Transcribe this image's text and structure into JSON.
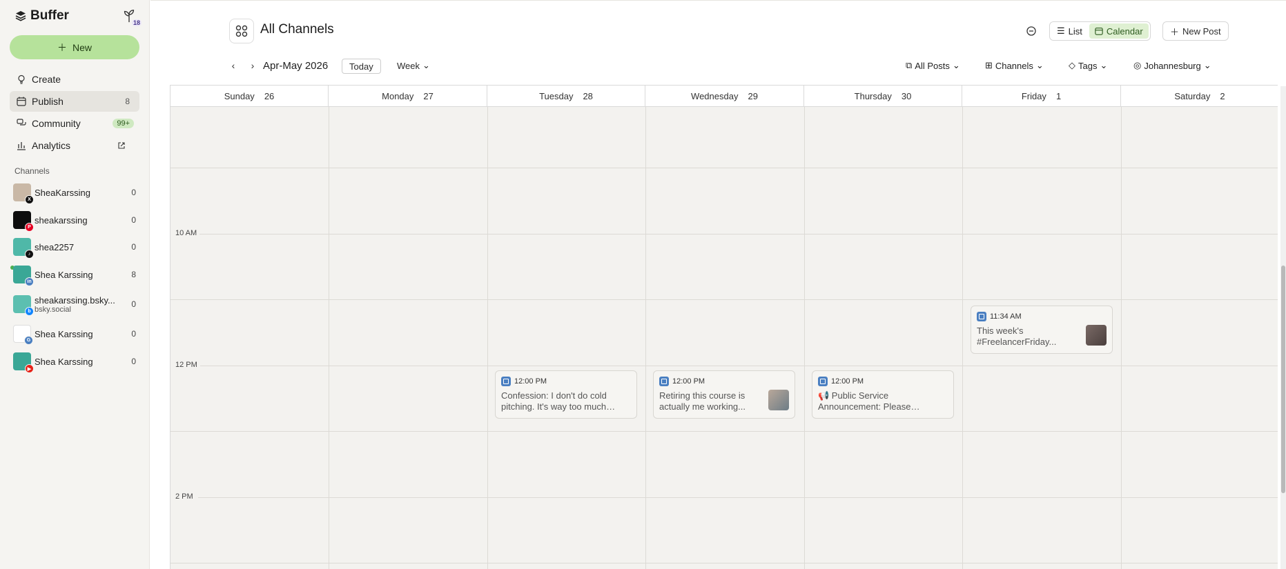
{
  "brand": {
    "name": "Buffer",
    "sprout_count": "18"
  },
  "sidebar": {
    "new_label": "New",
    "items": [
      {
        "label": "Create",
        "count": ""
      },
      {
        "label": "Publish",
        "count": "8"
      },
      {
        "label": "Community",
        "count": "99+"
      },
      {
        "label": "Analytics",
        "count": ""
      }
    ],
    "channels_title": "Channels",
    "channels": [
      {
        "name": "SheaKarssing",
        "sub": "",
        "count": "0",
        "network": "x-icon"
      },
      {
        "name": "sheakarssing",
        "sub": "",
        "count": "0",
        "network": "pinterest-icon"
      },
      {
        "name": "shea2257",
        "sub": "",
        "count": "0",
        "network": "tiktok-icon"
      },
      {
        "name": "Shea Karssing",
        "sub": "",
        "count": "8",
        "network": "linkedin-icon"
      },
      {
        "name": "sheakarssing.bsky...",
        "sub": "bsky.social",
        "count": "0",
        "network": "bluesky-icon"
      },
      {
        "name": "Shea Karssing",
        "sub": "",
        "count": "0",
        "network": "google-business-icon"
      },
      {
        "name": "Shea Karssing",
        "sub": "",
        "count": "0",
        "network": "youtube-icon"
      }
    ]
  },
  "header": {
    "title": "All Channels",
    "list_label": "List",
    "calendar_label": "Calendar",
    "new_post_label": "New Post",
    "range": "Apr-May 2026",
    "today_label": "Today",
    "week_label": "Week",
    "filters": {
      "posts": "All Posts",
      "channels": "Channels",
      "tags": "Tags",
      "timezone": "Johannesburg"
    }
  },
  "calendar": {
    "days": [
      {
        "name": "Sunday",
        "date": "26"
      },
      {
        "name": "Monday",
        "date": "27"
      },
      {
        "name": "Tuesday",
        "date": "28"
      },
      {
        "name": "Wednesday",
        "date": "29"
      },
      {
        "name": "Thursday",
        "date": "30"
      },
      {
        "name": "Friday",
        "date": "1"
      },
      {
        "name": "Saturday",
        "date": "2"
      }
    ],
    "time_labels": [
      "10 AM",
      "12 PM",
      "2 PM"
    ],
    "posts": [
      {
        "day": "Friday",
        "time": "11:34 AM",
        "text": "This week's #FreelancerFriday...",
        "has_thumb": true
      },
      {
        "day": "Tuesday",
        "time": "12:00 PM",
        "text": "Confession: I don't do cold pitching. It's way too much ha...",
        "has_thumb": false
      },
      {
        "day": "Wednesday",
        "time": "12:00 PM",
        "text": "Retiring this course is actually me working...",
        "has_thumb": true
      },
      {
        "day": "Thursday",
        "time": "12:00 PM",
        "text": "📢 Public Service Announcement: Please stop...",
        "has_thumb": false
      }
    ]
  },
  "colors": {
    "new_button": "#b6e29b",
    "calendar_selected": "#dff0d2",
    "linkedin": "#4a7fc1",
    "grid_bg": "#f3f2ef"
  }
}
